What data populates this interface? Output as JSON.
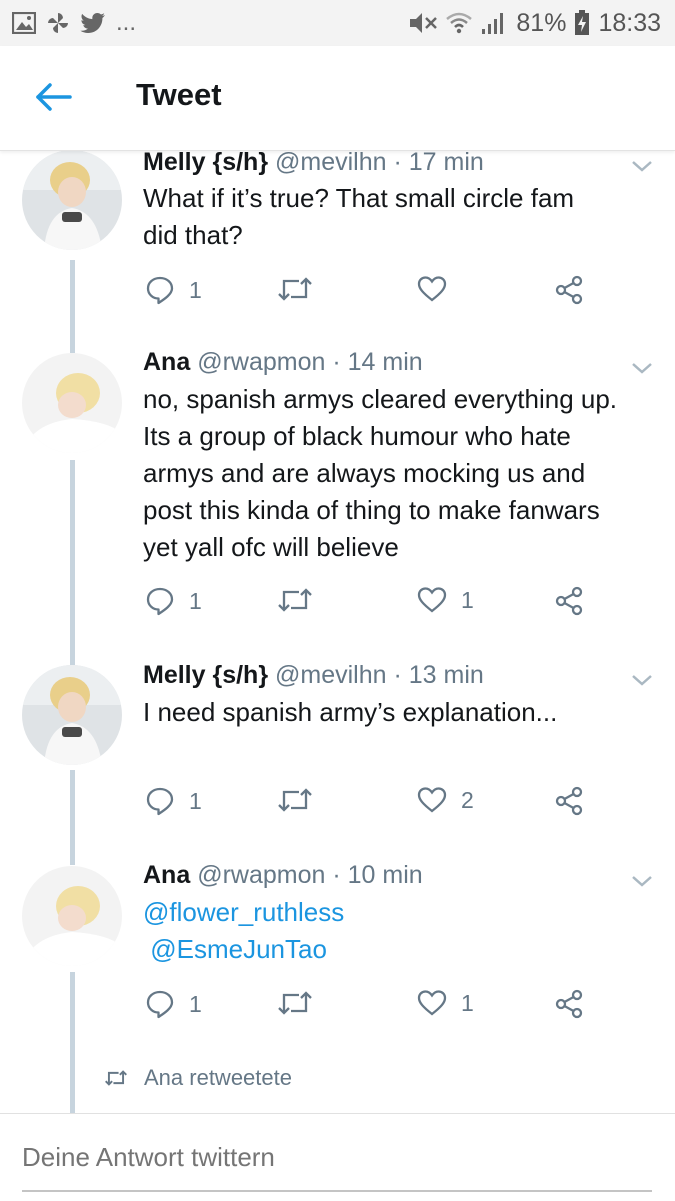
{
  "status_bar": {
    "battery": "81%",
    "time": "18:33",
    "ellipsis": "..."
  },
  "header": {
    "title": "Tweet"
  },
  "tweets": [
    {
      "name": "Melly {s/h}",
      "handle": "@mevilhn",
      "time": "· 17 min",
      "lines": [
        "What if it’s true? That small circle fam",
        "did that?"
      ],
      "replies": "1",
      "retweets": "",
      "likes": ""
    },
    {
      "name": "Ana",
      "handle": "@rwapmon",
      "time": "· 14 min",
      "lines": [
        "no, spanish armys cleared everything up.",
        "Its a group of black humour who hate",
        "armys and are always mocking us and",
        "post this kinda of thing to make fanwars",
        "yet yall ofc will believe"
      ],
      "replies": "1",
      "retweets": "",
      "likes": "1"
    },
    {
      "name": "Melly {s/h}",
      "handle": "@mevilhn",
      "time": "· 13 min",
      "lines": [
        "I need spanish army’s explanation..."
      ],
      "replies": "1",
      "retweets": "",
      "likes": "2"
    },
    {
      "name": "Ana",
      "handle": "@rwapmon",
      "time": "· 10 min",
      "mentions": [
        "@flower_ruthless",
        " @EsmeJunTao"
      ],
      "replies": "1",
      "retweets": "",
      "likes": "1"
    }
  ],
  "retweeted_label": "Ana retweetete",
  "reply": {
    "placeholder": "Deine Antwort twittern"
  },
  "colors": {
    "accent": "#1b95e0",
    "meta": "#657786",
    "thread_line": "#c7d4de"
  }
}
